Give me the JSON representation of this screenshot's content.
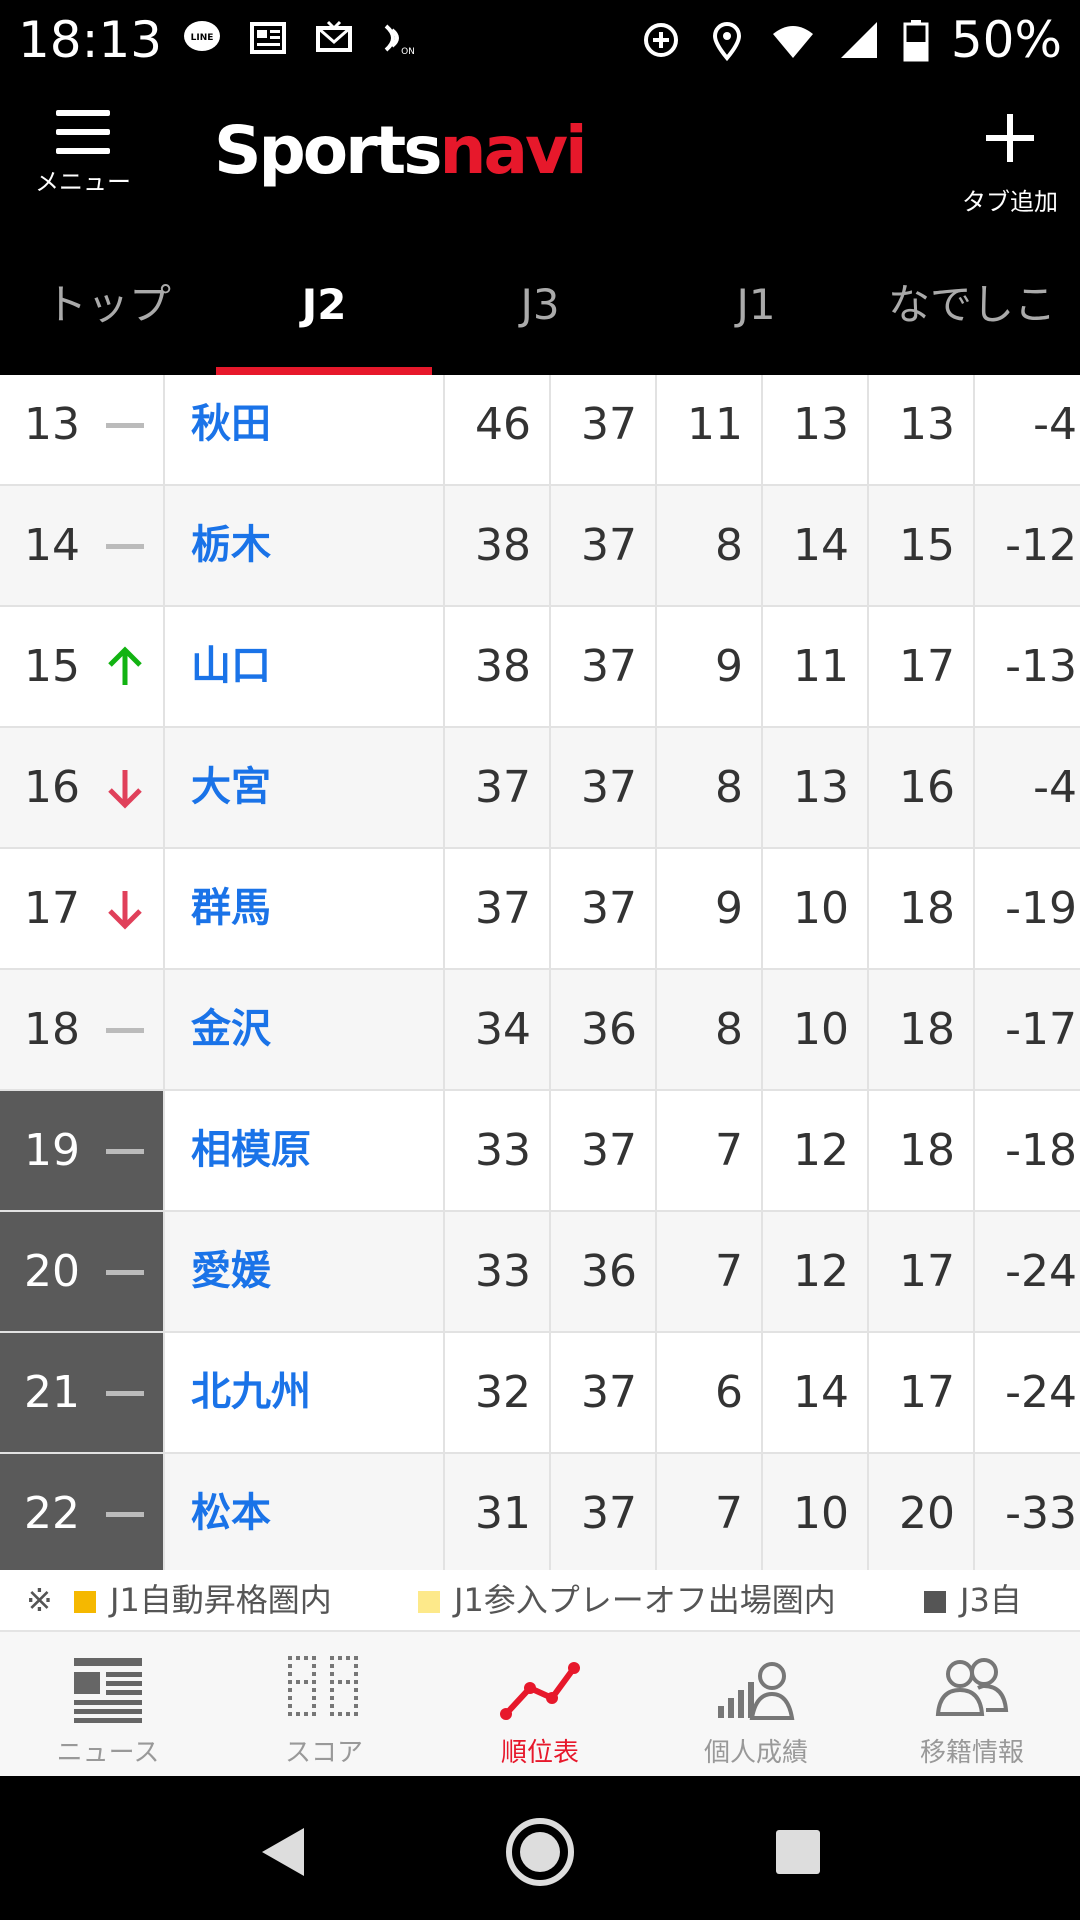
{
  "status_bar": {
    "time": "18:13",
    "battery": "50%",
    "icons_left": [
      "line-icon",
      "news-icon",
      "mail-icon",
      "nfc-icon"
    ],
    "icons_right": [
      "data-saver-icon",
      "location-icon",
      "wifi-icon",
      "signal-icon",
      "battery-icon"
    ]
  },
  "header": {
    "menu_label": "メニュー",
    "logo_primary": "Sports",
    "logo_accent": "navi",
    "add_tab_label": "タブ追加",
    "accent_color": "#e7182b"
  },
  "tabs": [
    {
      "label": "トップ",
      "active": false
    },
    {
      "label": "J2",
      "active": true
    },
    {
      "label": "J3",
      "active": false
    },
    {
      "label": "J1",
      "active": false
    },
    {
      "label": "なでしこ",
      "active": false
    }
  ],
  "standings": {
    "rows": [
      {
        "rank": "13",
        "trend": "same",
        "team": "秋田",
        "stats": [
          "46",
          "37",
          "11",
          "13",
          "13",
          "-4"
        ],
        "zone": "none"
      },
      {
        "rank": "14",
        "trend": "same",
        "team": "栃木",
        "stats": [
          "38",
          "37",
          "8",
          "14",
          "15",
          "-12"
        ],
        "zone": "none"
      },
      {
        "rank": "15",
        "trend": "up",
        "team": "山口",
        "stats": [
          "38",
          "37",
          "9",
          "11",
          "17",
          "-13"
        ],
        "zone": "none"
      },
      {
        "rank": "16",
        "trend": "down",
        "team": "大宮",
        "stats": [
          "37",
          "37",
          "8",
          "13",
          "16",
          "-4"
        ],
        "zone": "none"
      },
      {
        "rank": "17",
        "trend": "down",
        "team": "群馬",
        "stats": [
          "37",
          "37",
          "9",
          "10",
          "18",
          "-19"
        ],
        "zone": "none"
      },
      {
        "rank": "18",
        "trend": "same",
        "team": "金沢",
        "stats": [
          "34",
          "36",
          "8",
          "10",
          "18",
          "-17"
        ],
        "zone": "none"
      },
      {
        "rank": "19",
        "trend": "same",
        "team": "相模原",
        "stats": [
          "33",
          "37",
          "7",
          "12",
          "18",
          "-18"
        ],
        "zone": "relegation"
      },
      {
        "rank": "20",
        "trend": "same",
        "team": "愛媛",
        "stats": [
          "33",
          "36",
          "7",
          "12",
          "17",
          "-24"
        ],
        "zone": "relegation"
      },
      {
        "rank": "21",
        "trend": "same",
        "team": "北九州",
        "stats": [
          "32",
          "37",
          "6",
          "14",
          "17",
          "-24"
        ],
        "zone": "relegation"
      },
      {
        "rank": "22",
        "trend": "same",
        "team": "松本",
        "stats": [
          "31",
          "37",
          "7",
          "10",
          "20",
          "-33"
        ],
        "zone": "relegation"
      }
    ],
    "trend_colors": {
      "up": "#12b312",
      "down": "#e0405a",
      "same": "#bbbbbb"
    }
  },
  "legend": {
    "mark": "※",
    "items": [
      {
        "label": "J1自動昇格圏内",
        "color": "#f5b800"
      },
      {
        "label": "J1参入プレーオフ出場圏内",
        "color": "#fde98a"
      },
      {
        "label": "J3自",
        "color": "#555555"
      }
    ]
  },
  "bottom_nav": [
    {
      "label": "ニュース",
      "icon": "news-icon",
      "active": false
    },
    {
      "label": "スコア",
      "icon": "scoreboard-icon",
      "active": false
    },
    {
      "label": "順位表",
      "icon": "standings-chart-icon",
      "active": true
    },
    {
      "label": "個人成績",
      "icon": "player-stats-icon",
      "active": false
    },
    {
      "label": "移籍情報",
      "icon": "transfer-icon",
      "active": false
    }
  ],
  "system_nav": [
    "back-icon",
    "home-icon",
    "recents-icon"
  ]
}
